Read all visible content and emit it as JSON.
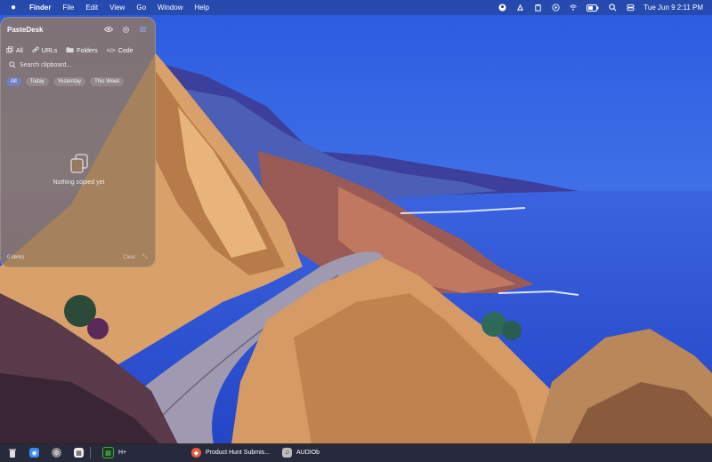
{
  "menubar": {
    "app_name": "Finder",
    "menus": [
      "File",
      "Edit",
      "View",
      "Go",
      "Window",
      "Help"
    ],
    "clock": "Tue Jun 9  2:11 PM",
    "status_icons": [
      "user-icon",
      "pen-icon",
      "clipboard-icon",
      "play-circle-icon",
      "wifi-icon",
      "battery-icon",
      "search-icon",
      "control-center-icon"
    ]
  },
  "panel": {
    "title": "PasteDesk",
    "categories": [
      {
        "label": "All",
        "icon": "copy-icon"
      },
      {
        "label": "URLs",
        "icon": "link-icon"
      },
      {
        "label": "Folders",
        "icon": "folder-icon"
      },
      {
        "label": "Code",
        "icon": "code-icon"
      }
    ],
    "search": {
      "placeholder": "Search clipboard..."
    },
    "filters": [
      {
        "label": "All",
        "active": true
      },
      {
        "label": "Today",
        "active": false
      },
      {
        "label": "Yesterday",
        "active": false
      },
      {
        "label": "This Week",
        "active": false
      }
    ],
    "empty_message": "Nothing copied yet",
    "item_count": "0 items",
    "clear_label": "Clear"
  },
  "dock": {
    "items": [
      {
        "icon": "trash-icon",
        "label": ""
      },
      {
        "icon": "finder-icon",
        "label": ""
      },
      {
        "icon": "settings-icon",
        "label": ""
      },
      {
        "icon": "calendar-icon",
        "label": ""
      },
      {
        "icon": "terminal-icon",
        "label": "H+"
      },
      {
        "icon": "browser-icon",
        "label": "Product Hunt Submis..."
      },
      {
        "icon": "audio-app-icon",
        "label": "AUDIOb"
      }
    ]
  },
  "colors": {
    "panel_accent": "#6e82d2",
    "sea": "#2f55d8",
    "sky": "#3f6ce0"
  }
}
